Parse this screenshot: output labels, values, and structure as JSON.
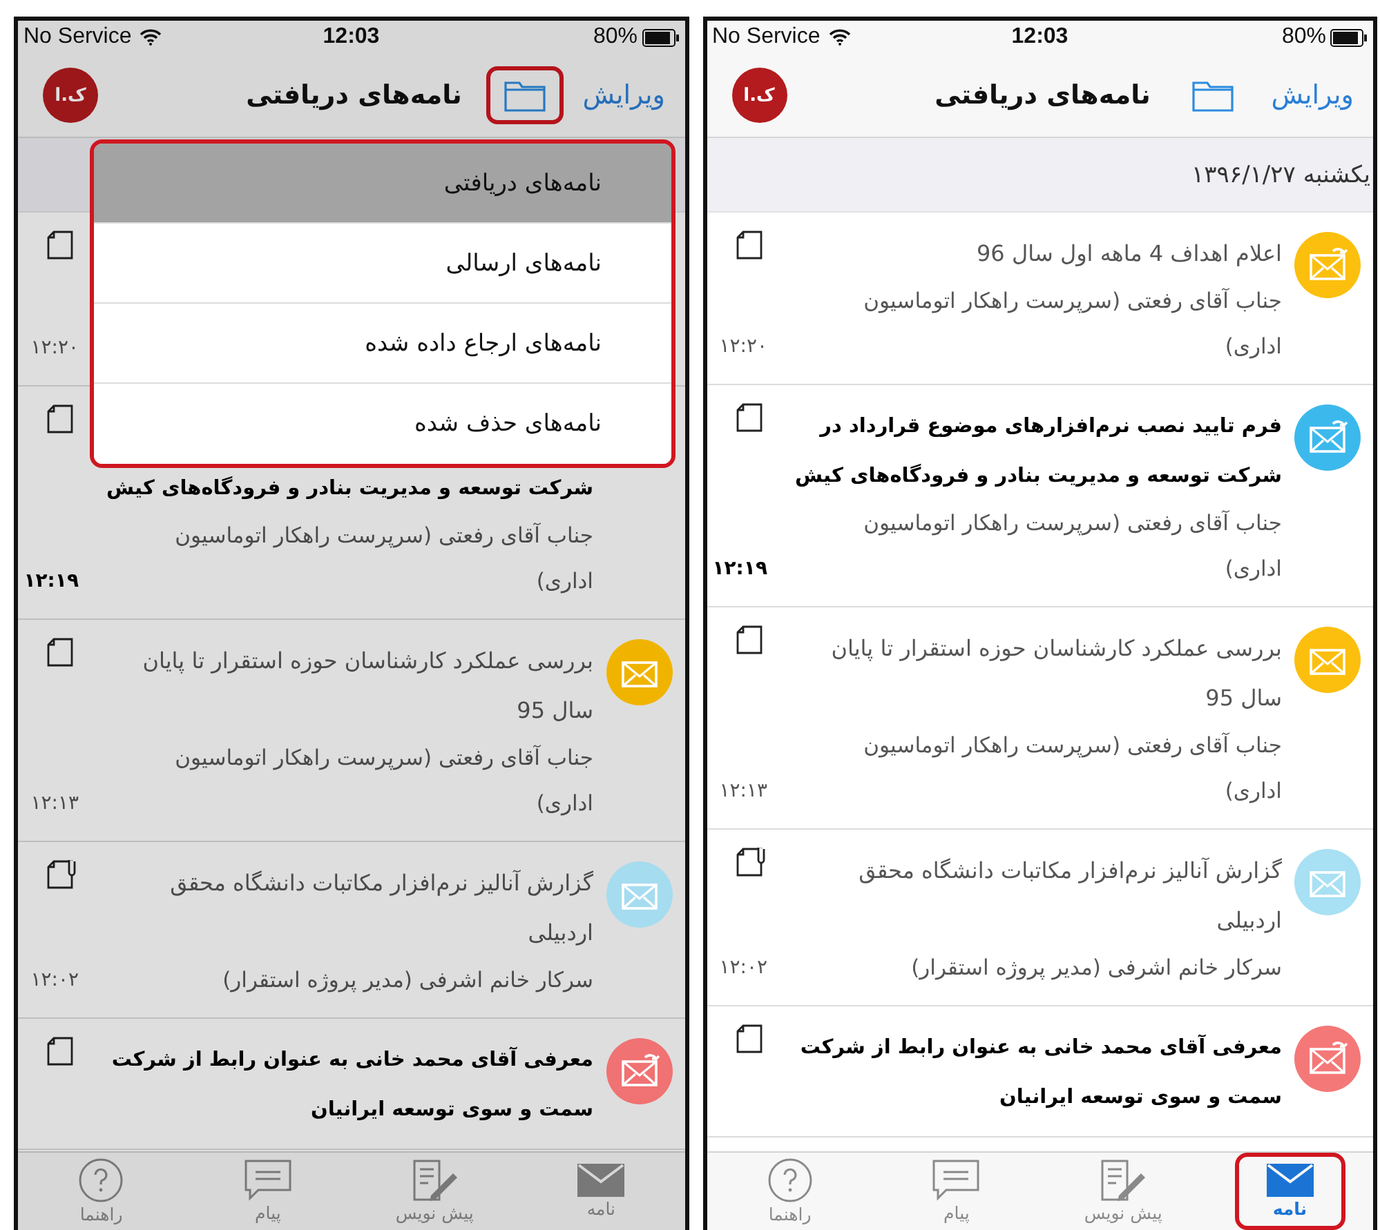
{
  "screens": [
    {
      "dimmed": false,
      "status_bar": {
        "carrier": "No Service",
        "time": "12:03",
        "battery": "80%"
      },
      "header": {
        "avatar": "ک.ا",
        "title": "نامه‌های دریافتی",
        "edit": "ویرایش",
        "folder_annotated": false
      },
      "date": "یکشنبه ۱۳۹۶/۱/۲۷",
      "messages": [
        {
          "title_lines": [
            "اعلام اهداف  4 ماهه اول سال 96"
          ],
          "sender_lines": [
            "جناب آقای رفعتی (سرپرست راهکار اتوماسیون",
            "اداری)"
          ],
          "time": "۱۲:۲۰",
          "unread": false,
          "attachment": false,
          "color": "#fcbf0e",
          "replied": true
        },
        {
          "title_lines": [
            "فرم تایید نصب نرم‌افزارهای موضوع قرارداد در",
            "شرکت توسعه و مدیریت بنادر و فرودگاه‌های کیش"
          ],
          "sender_lines": [
            "جناب آقای رفعتی (سرپرست راهکار اتوماسیون",
            "اداری)"
          ],
          "time": "۱۲:۱۹",
          "unread": true,
          "attachment": false,
          "color": "#3cb9ec",
          "replied": true
        },
        {
          "title_lines": [
            "بررسی عملکرد کارشناسان حوزه استقرار تا پایان",
            "سال 95"
          ],
          "sender_lines": [
            "جناب آقای رفعتی (سرپرست راهکار اتوماسیون",
            "اداری)"
          ],
          "time": "۱۲:۱۳",
          "unread": false,
          "attachment": false,
          "color": "#fcbf0e",
          "replied": false
        },
        {
          "title_lines": [
            "گزارش آنالیز نرم‌افزار مکاتبات دانشگاه محقق",
            "اردبیلی"
          ],
          "sender_lines": [
            "سرکار خانم اشرفی (مدیر پروژه استقرار)"
          ],
          "time": "۱۲:۰۲",
          "unread": false,
          "attachment": true,
          "color": "#a8e0f4",
          "replied": false
        },
        {
          "title_lines": [
            "معرفی آقای محمد خانی به عنوان رابط از شرکت",
            "سمت و سوی توسعه ایرانیان"
          ],
          "unread": true,
          "attachment": false,
          "color": "#f57878",
          "replied": true
        }
      ],
      "tab_bar": [
        {
          "label": "نامه",
          "kind": "mail",
          "selected": true,
          "annotated": true
        },
        {
          "label": "پیش نویس",
          "kind": "draft",
          "selected": false,
          "annotated": false
        },
        {
          "label": "پیام",
          "kind": "message",
          "selected": false,
          "annotated": false
        },
        {
          "label": "راهنما",
          "kind": "help",
          "selected": false,
          "annotated": false
        }
      ]
    },
    {
      "dimmed": true,
      "status_bar": {
        "carrier": "No Service",
        "time": "12:03",
        "battery": "80%"
      },
      "header": {
        "avatar": "ک.ا",
        "title": "نامه‌های دریافتی",
        "edit": "ویرایش",
        "folder_annotated": true
      },
      "menu": {
        "annotated": true,
        "items": [
          {
            "label": "نامه‌های دریافتی",
            "selected": true
          },
          {
            "label": "نامه‌های ارسالی",
            "selected": false
          },
          {
            "label": "نامه‌های ارجاع داده شده",
            "selected": false
          },
          {
            "label": "نامه‌های حذف شده",
            "selected": false
          }
        ]
      },
      "messages": [
        {
          "covered": true,
          "time": "۱۲:۲۰",
          "unread": false,
          "attachment": false
        },
        {
          "covered": true,
          "title_lines": [
            "شرکت توسعه و مدیریت بنادر و فرودگاه‌های کیش"
          ],
          "sender_lines": [
            "جناب آقای رفعتی (سرپرست راهکار اتوماسیون",
            "اداری)"
          ],
          "time": "۱۲:۱۹",
          "unread": true,
          "attachment": false
        },
        {
          "title_lines": [
            "بررسی عملکرد کارشناسان حوزه استقرار تا پایان",
            "سال 95"
          ],
          "sender_lines": [
            "جناب آقای رفعتی (سرپرست راهکار اتوماسیون",
            "اداری)"
          ],
          "time": "۱۲:۱۳",
          "unread": false,
          "attachment": false,
          "color": "#f0b400",
          "replied": false
        },
        {
          "title_lines": [
            "گزارش آنالیز نرم‌افزار مکاتبات دانشگاه محقق",
            "اردبیلی"
          ],
          "sender_lines": [
            "سرکار خانم اشرفی (مدیر پروژه استقرار)"
          ],
          "time": "۱۲:۰۲",
          "unread": false,
          "attachment": true,
          "color": "#a6dcf0",
          "replied": false
        },
        {
          "title_lines": [
            "معرفی آقای محمد خانی به عنوان رابط از شرکت",
            "سمت و سوی توسعه ایرانیان"
          ],
          "unread": true,
          "attachment": false,
          "color": "#f07272",
          "replied": true
        }
      ],
      "tab_bar": [
        {
          "label": "نامه",
          "kind": "mail",
          "selected": false,
          "annotated": false
        },
        {
          "label": "پیش نویس",
          "kind": "draft",
          "selected": false,
          "annotated": false
        },
        {
          "label": "پیام",
          "kind": "message",
          "selected": false,
          "annotated": false
        },
        {
          "label": "راهنما",
          "kind": "help",
          "selected": false,
          "annotated": false
        }
      ]
    }
  ]
}
